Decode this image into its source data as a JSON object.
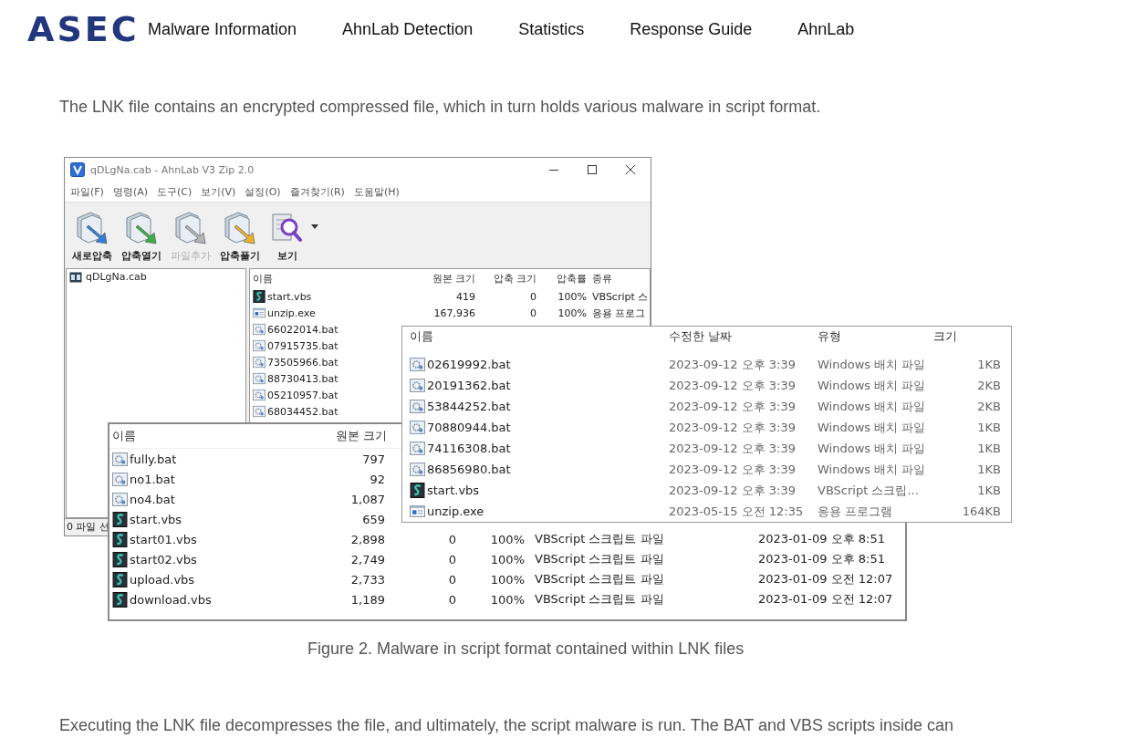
{
  "header": {
    "logo": "ASEC",
    "nav": [
      "Malware Information",
      "AhnLab Detection",
      "Statistics",
      "Response Guide",
      "AhnLab"
    ]
  },
  "intro": "The LNK file contains an encrypted compressed file, which in turn holds various malware in script format.",
  "figure": {
    "archive_window": {
      "title": "qDLgNa.cab - AhnLab V3 Zip 2.0",
      "menu": [
        "파일(F)",
        "명령(A)",
        "도구(C)",
        "보기(V)",
        "설정(O)",
        "즐겨찾기(R)",
        "도움말(H)"
      ],
      "toolbar": [
        {
          "kind": "new",
          "label": "새로압축",
          "disabled": false
        },
        {
          "kind": "open",
          "label": "압축열기",
          "disabled": false
        },
        {
          "kind": "add",
          "label": "파일추가",
          "disabled": true
        },
        {
          "kind": "extract",
          "label": "압축풀기",
          "disabled": false
        },
        {
          "kind": "view",
          "label": "보기",
          "disabled": false
        }
      ],
      "tree": [
        "qDLgNa.cab"
      ],
      "columns": [
        "이름",
        "원본 크기",
        "압축 크기",
        "압축률",
        "종류"
      ],
      "rows": [
        {
          "kind": "vbs",
          "name": "start.vbs",
          "original": "419",
          "compressed": "0",
          "ratio": "100%",
          "type": "VBScript 스"
        },
        {
          "kind": "exe",
          "name": "unzip.exe",
          "original": "167,936",
          "compressed": "0",
          "ratio": "100%",
          "type": "응용 프로그"
        },
        {
          "kind": "bat",
          "name": "66022014.bat"
        },
        {
          "kind": "bat",
          "name": "07915735.bat"
        },
        {
          "kind": "bat",
          "name": "73505966.bat"
        },
        {
          "kind": "bat",
          "name": "88730413.bat"
        },
        {
          "kind": "bat",
          "name": "05210957.bat"
        },
        {
          "kind": "bat",
          "name": "68034452.bat"
        }
      ],
      "status": "0 파일 선"
    },
    "list_window": {
      "columns": [
        "이름",
        "원본 크기"
      ],
      "rows": [
        {
          "kind": "bat",
          "name": "fully.bat",
          "original": "797"
        },
        {
          "kind": "bat",
          "name": "no1.bat",
          "original": "92"
        },
        {
          "kind": "bat",
          "name": "no4.bat",
          "original": "1,087"
        },
        {
          "kind": "vbs",
          "name": "start.vbs",
          "original": "659"
        },
        {
          "kind": "vbs",
          "name": "start01.vbs",
          "original": "2,898",
          "compressed": "0",
          "ratio": "100%",
          "type": "VBScript 스크립트 파일",
          "date": "2023-01-09 오후 8:51"
        },
        {
          "kind": "vbs",
          "name": "start02.vbs",
          "original": "2,749",
          "compressed": "0",
          "ratio": "100%",
          "type": "VBScript 스크립트 파일",
          "date": "2023-01-09 오후 8:51"
        },
        {
          "kind": "vbs",
          "name": "upload.vbs",
          "original": "2,733",
          "compressed": "0",
          "ratio": "100%",
          "type": "VBScript 스크립트 파일",
          "date": "2023-01-09 오전 12:07"
        },
        {
          "kind": "vbs",
          "name": "download.vbs",
          "original": "1,189",
          "compressed": "0",
          "ratio": "100%",
          "type": "VBScript 스크립트 파일",
          "date": "2023-01-09 오전 12:07"
        }
      ]
    },
    "explorer_window": {
      "columns": [
        "이름",
        "수정한 날짜",
        "유형",
        "크기"
      ],
      "rows": [
        {
          "kind": "bat",
          "name": "02619992.bat",
          "modified": "2023-09-12 오후 3:39",
          "type": "Windows 배치 파일",
          "size": "1KB"
        },
        {
          "kind": "bat",
          "name": "20191362.bat",
          "modified": "2023-09-12 오후 3:39",
          "type": "Windows 배치 파일",
          "size": "2KB"
        },
        {
          "kind": "bat",
          "name": "53844252.bat",
          "modified": "2023-09-12 오후 3:39",
          "type": "Windows 배치 파일",
          "size": "2KB"
        },
        {
          "kind": "bat",
          "name": "70880944.bat",
          "modified": "2023-09-12 오후 3:39",
          "type": "Windows 배치 파일",
          "size": "1KB"
        },
        {
          "kind": "bat",
          "name": "74116308.bat",
          "modified": "2023-09-12 오후 3:39",
          "type": "Windows 배치 파일",
          "size": "1KB"
        },
        {
          "kind": "bat",
          "name": "86856980.bat",
          "modified": "2023-09-12 오후 3:39",
          "type": "Windows 배치 파일",
          "size": "1KB"
        },
        {
          "kind": "vbs",
          "name": "start.vbs",
          "modified": "2023-09-12 오후 3:39",
          "type": "VBScript 스크립...",
          "size": "1KB"
        },
        {
          "kind": "exe",
          "name": "unzip.exe",
          "modified": "2023-05-15 오전 12:35",
          "type": "응용 프로그램",
          "size": "164KB"
        }
      ]
    }
  },
  "caption": "Figure 2. Malware in script format contained within LNK files",
  "body": "Executing the LNK file decompresses the file, and ultimately, the script malware is run. The BAT and VBS scripts inside can"
}
